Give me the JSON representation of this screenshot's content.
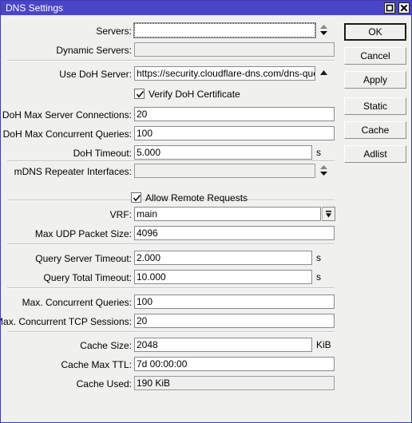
{
  "window": {
    "title": "DNS Settings",
    "accent_color": "#4a45c8",
    "face_color": "#f0f0ef",
    "controls": [
      {
        "name": "maximize",
        "glyph": "square"
      },
      {
        "name": "close",
        "glyph": "x"
      }
    ]
  },
  "form": {
    "fields": [
      {
        "label": "Servers:",
        "value": "",
        "unit": "",
        "state": "focused",
        "adornment": "spinner"
      },
      {
        "label": "Dynamic Servers:",
        "value": "",
        "unit": "",
        "state": "readonly",
        "adornment": "none"
      },
      {
        "label": "Use DoH Server:",
        "value": "https://security.cloudflare-dns.com/dns-query",
        "unit": "",
        "state": "editable",
        "adornment": "collapse-arrow"
      },
      {
        "label": "DoH Max Server Connections:",
        "value": "20",
        "unit": "",
        "state": "editable",
        "adornment": "none"
      },
      {
        "label": "DoH Max Concurrent Queries:",
        "value": "100",
        "unit": "",
        "state": "editable",
        "adornment": "none"
      },
      {
        "label": "DoH Timeout:",
        "value": "5.000",
        "unit": "s",
        "state": "editable",
        "adornment": "none"
      },
      {
        "label": "mDNS Repeater Interfaces:",
        "value": "",
        "unit": "",
        "state": "readonly",
        "adornment": "spinner"
      },
      {
        "label": "VRF:",
        "value": "main",
        "unit": "",
        "state": "editable",
        "adornment": "dropdown"
      },
      {
        "label": "Max UDP Packet Size:",
        "value": "4096",
        "unit": "",
        "state": "editable",
        "adornment": "none"
      },
      {
        "label": "Query Server Timeout:",
        "value": "2.000",
        "unit": "s",
        "state": "editable",
        "adornment": "none"
      },
      {
        "label": "Query Total Timeout:",
        "value": "10.000",
        "unit": "s",
        "state": "editable",
        "adornment": "none"
      },
      {
        "label": "Max. Concurrent Queries:",
        "value": "100",
        "unit": "",
        "state": "editable",
        "adornment": "none"
      },
      {
        "label": "Max. Concurrent TCP Sessions:",
        "value": "20",
        "unit": "",
        "state": "editable",
        "adornment": "none"
      },
      {
        "label": "Cache Size:",
        "value": "2048",
        "unit": "KiB",
        "state": "editable",
        "adornment": "none"
      },
      {
        "label": "Cache Max TTL:",
        "value": "7d 00:00:00",
        "unit": "",
        "state": "editable",
        "adornment": "none"
      },
      {
        "label": "Cache Used:",
        "value": "190 KiB",
        "unit": "",
        "state": "readonly",
        "adornment": "none"
      }
    ],
    "checkboxes": [
      {
        "label": "Verify DoH Certificate",
        "checked": true
      },
      {
        "label": "Allow Remote Requests",
        "checked": true
      }
    ]
  },
  "buttons": [
    {
      "label": "OK",
      "default": true
    },
    {
      "label": "Cancel",
      "default": false
    },
    {
      "label": "Apply",
      "default": false
    },
    {
      "label": "Static",
      "default": false
    },
    {
      "label": "Cache",
      "default": false
    },
    {
      "label": "Adlist",
      "default": false
    }
  ]
}
